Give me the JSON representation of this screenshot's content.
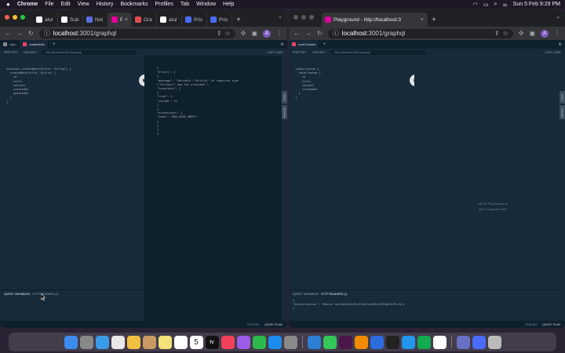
{
  "menubar": {
    "apple": "",
    "items": [
      "Chrome",
      "File",
      "Edit",
      "View",
      "History",
      "Bookmarks",
      "Profiles",
      "Tab",
      "Window",
      "Help"
    ],
    "clock": "Sun 5 Feb  9:29 PM"
  },
  "left_window": {
    "tabs": [
      {
        "label": "atul",
        "fav": "#ffffff",
        "active": false
      },
      {
        "label": "Sub",
        "fav": "#ffffff",
        "active": false
      },
      {
        "label": "Not",
        "fav": "#5b6ee1",
        "active": false
      },
      {
        "label": "P",
        "fav": "#e10098",
        "active": true
      },
      {
        "label": "Gra",
        "fav": "#e34c4c",
        "active": false
      },
      {
        "label": "atul",
        "fav": "#ffffff",
        "active": false
      },
      {
        "label": "Pris",
        "fav": "#4a6cf7",
        "active": false
      },
      {
        "label": "Pris",
        "fav": "#4a6cf7",
        "active": false
      }
    ],
    "url_host": "localhost",
    "url_rest": ":3001/graphql",
    "avatar": "A",
    "playground_tabs": [
      "login",
      "createNote"
    ],
    "toolbar": {
      "prettify": "PRETTIFY",
      "history": "HISTORY",
      "url": "http://localhost:3001/graphql",
      "copy": "COPY CURL"
    },
    "query_lines": [
      "  mutation createNote($title: String!) {",
      "    createNote(title: $title) {",
      "      id",
      "      title",
      "      content",
      "      createdAt",
      "      updatedAt",
      "    }",
      "  }"
    ],
    "result_lines": [
      "{",
      "  \"errors\": [",
      "    {",
      "      \"message\": \"Variable \\\"$title\\\" of required type",
      "  \\\"String!\\\" was not provided.\",",
      "      \"locations\": [",
      "        {",
      "          \"line\": 1,",
      "          \"column\": 21",
      "        }",
      "      ],",
      "      \"extensions\": {",
      "        \"code\": \"BAD_USER_INPUT\"",
      "      }",
      "    }",
      "  ]",
      "}"
    ],
    "query_variables": "QUERY VARIABLES",
    "http_headers": "HTTP HEADERS (1)",
    "status": {
      "tracing": "TRACING",
      "plan": "QUERY PLAN"
    },
    "side": {
      "docs": "DOCS",
      "schema": "SCHEMA"
    }
  },
  "right_window": {
    "tab_label": "Playground - http://localhost:3",
    "url_host": "localhost",
    "url_rest": ":3001/graphql",
    "avatar": "A",
    "playground_tabs": [
      "noteCreated"
    ],
    "toolbar": {
      "prettify": "PRETTIFY",
      "history": "HISTORY",
      "url": "http://localhost:3001/graphql",
      "copy": "COPY CURL"
    },
    "query_lines": [
      "  subscription {",
      "    noteCreated {",
      "      id",
      "      title",
      "      content",
      "      createdAt",
      "    }",
      "  }"
    ],
    "hint": [
      "Hit the Play Button to",
      "get a response here"
    ],
    "query_variables": "QUERY VARIABLES",
    "http_headers": "HTTP HEADERS (1)",
    "headers_lines": [
      "{",
      "  \"Authorization\": \"Bearer eyJhbGciOiJIUzI1NiIsInR5cCI6IkpXVCJ9.eyJs",
      "}"
    ],
    "status": {
      "tracing": "TRACING",
      "plan": "QUERY PLAN"
    },
    "side": {
      "docs": "DOCS",
      "schema": "SCHEMA"
    }
  },
  "dock": {
    "calendar_day": "5",
    "tv_label": "tv",
    "apps": [
      "finder-icon",
      "launchpad-icon",
      "safari-icon",
      "chrome-icon",
      "photos-icon",
      "contacts-icon",
      "notes-icon",
      "reminders-icon",
      "calendar-icon",
      "tv-icon",
      "music-icon",
      "podcasts-icon",
      "numbers-icon",
      "appstore-icon",
      "settings-icon",
      "vscode-icon",
      "messages-icon",
      "slack-icon",
      "vlc-icon",
      "keynote-icon",
      "terminal-icon",
      "docker-icon",
      "mongodb-icon",
      "obs-icon",
      "files-icon",
      "downloads-icon",
      "trash-icon"
    ],
    "colors": [
      "#3d8cf0",
      "#888888",
      "#3a9be8",
      "#e8e8e8",
      "#f0c040",
      "#c89a62",
      "#f5e27a",
      "#ffffff",
      "#ffffff",
      "#111111",
      "#f0405a",
      "#9b5de5",
      "#2db84d",
      "#1c8cf0",
      "#8a8a8a",
      "#2b7fd4",
      "#34c759",
      "#4a154b",
      "#f38b00",
      "#2d6cdf",
      "#222222",
      "#2496ed",
      "#13aa52",
      "#ffffff",
      "#6a6fc4",
      "#4a6cf7",
      "#bbbbbb"
    ]
  }
}
